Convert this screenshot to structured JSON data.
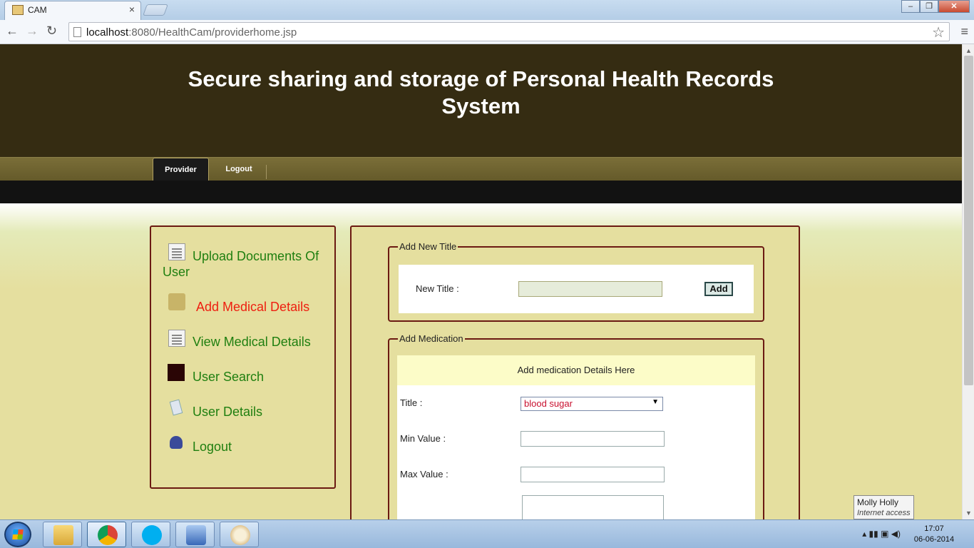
{
  "browser": {
    "tab_title": "CAM",
    "url_host": "localhost",
    "url_rest": ":8080/HealthCam/providerhome.jsp"
  },
  "site": {
    "title_line1": "Secure sharing and storage of Personal Health Records",
    "title_line2": "System"
  },
  "nav": {
    "tabs": [
      {
        "label": "Provider",
        "active": true
      },
      {
        "label": "Logout",
        "active": false
      }
    ]
  },
  "sidebar": {
    "items": [
      {
        "label": "Upload Documents Of",
        "label2": "User",
        "icon": "document-icon",
        "active": false
      },
      {
        "label": "Add Medical Details",
        "icon": "doctor-icon",
        "active": true
      },
      {
        "label": "View Medical Details",
        "icon": "document-icon",
        "active": false
      },
      {
        "label": "User Search",
        "icon": "dark-square-icon",
        "active": false
      },
      {
        "label": "User Details",
        "icon": "clipboard-icon",
        "active": false
      },
      {
        "label": "Logout",
        "icon": "user-icon",
        "active": false
      }
    ]
  },
  "add_title": {
    "legend": "Add New Title",
    "label": "New Title :",
    "value": "",
    "button": "Add"
  },
  "add_medication": {
    "legend": "Add Medication",
    "heading": "Add medication Details Here",
    "title_label": "Title :",
    "title_selected": "blood sugar",
    "min_label": "Min Value :",
    "min_value": "",
    "max_label": "Max Value :",
    "max_value": ""
  },
  "tooltip": {
    "name": "Molly Holly",
    "status": "Internet access"
  },
  "taskbar": {
    "time": "17:07",
    "date": "06-06-2014"
  }
}
